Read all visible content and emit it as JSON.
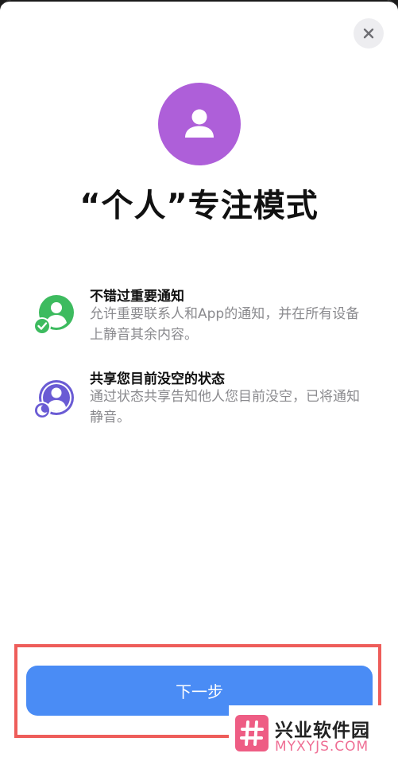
{
  "dialog": {
    "title": "“个人”专注模式",
    "close_icon": "close-icon",
    "hero_icon": "person-icon",
    "hero_color": "#ae5fd9"
  },
  "features": [
    {
      "icon": "person-checkmark-icon",
      "title": "不错过重要通知",
      "description": "允许重要联系人和App的通知，并在所有设备上静音其余内容。",
      "color": "#3dbb5f"
    },
    {
      "icon": "person-moon-icon",
      "title": "共享您目前没空的状态",
      "description": "通过状态共享告知他人您目前没空，已将通知静音。",
      "color": "#6a5bd4"
    }
  ],
  "actions": {
    "next_label": "下一步",
    "button_color": "#4a8cf5",
    "highlight_color": "#ee5d5a"
  },
  "watermark": {
    "name": "兴业软件园",
    "url": "MYXYJS.COM",
    "logo_icon": "hash-logo-icon"
  }
}
